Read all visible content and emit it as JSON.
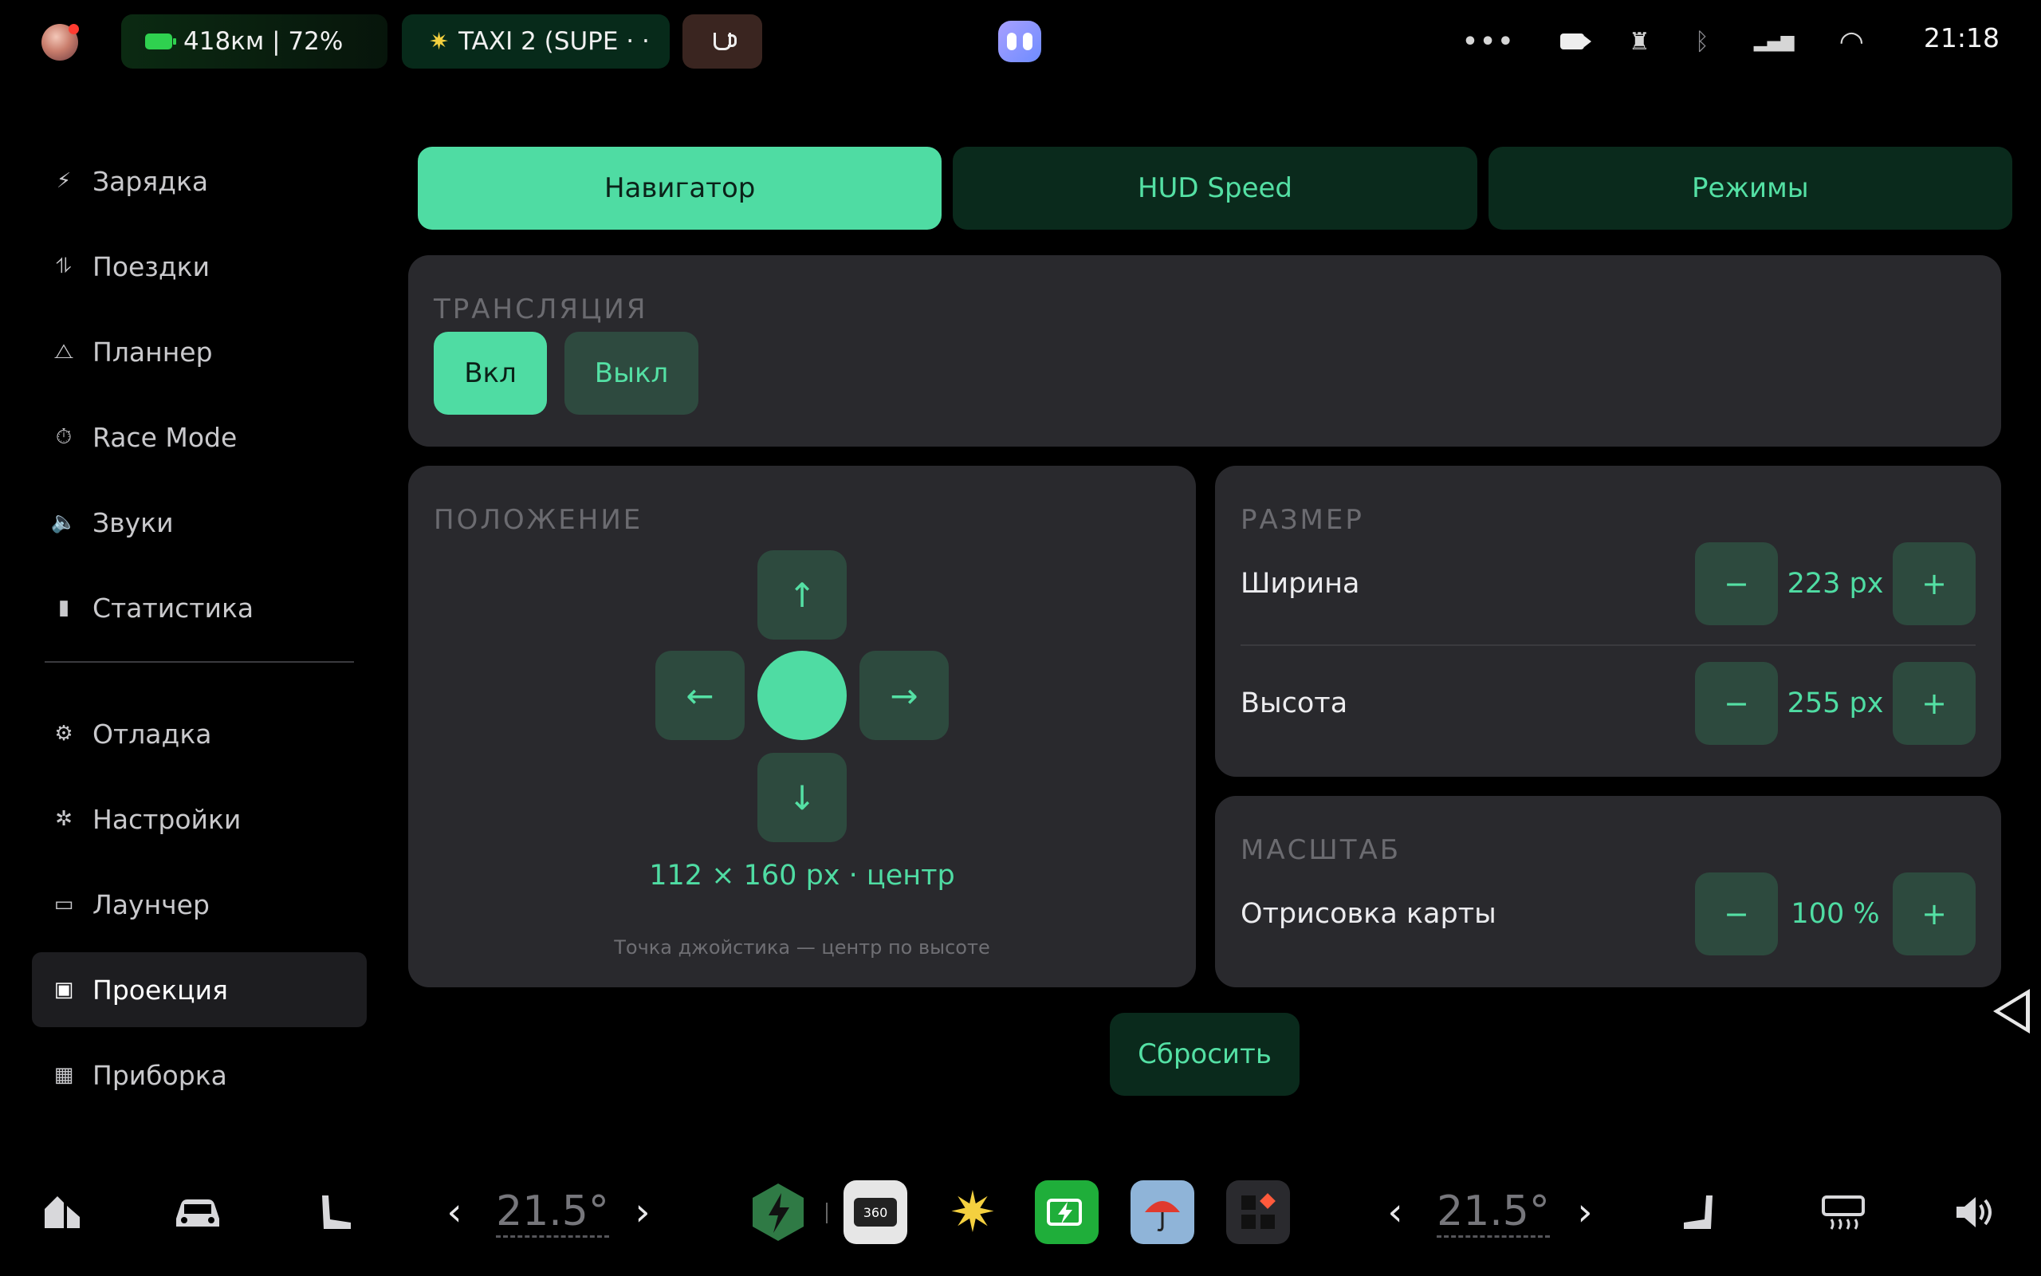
{
  "status_bar": {
    "battery_text": "418км | 72%",
    "taxi_text": "TAXI 2 (SUPE · ·",
    "time": "21:18",
    "icons": [
      "more-dots-icon",
      "camera-icon",
      "alarm-icon",
      "bluetooth-icon",
      "cellular-4g-icon",
      "wifi-icon"
    ],
    "more_symbol": "•••",
    "alarm_symbol": "♜",
    "bluetooth_symbol": "ᛒ",
    "cell_symbol": "▂▄▆",
    "wifi_symbol": "◠"
  },
  "sidebar": {
    "items": [
      {
        "label": "Зарядка",
        "icon": "⚡"
      },
      {
        "label": "Поездки",
        "icon": "⥮"
      },
      {
        "label": "Планнер",
        "icon": "⧍"
      },
      {
        "label": "Race Mode",
        "icon": "⏱"
      },
      {
        "label": "Звуки",
        "icon": "🔈"
      },
      {
        "label": "Статистика",
        "icon": "▮"
      },
      {
        "label": "Отладка",
        "icon": "⚙"
      },
      {
        "label": "Настройки",
        "icon": "✲"
      },
      {
        "label": "Лаунчер",
        "icon": "▭"
      },
      {
        "label": "Проекция",
        "icon": "▣"
      },
      {
        "label": "Приборка",
        "icon": "▦"
      }
    ],
    "active_index": 9
  },
  "tabs": [
    "Навигатор",
    "HUD Speed",
    "Режимы"
  ],
  "active_tab": 0,
  "translation": {
    "title": "ТРАНСЛЯЦИЯ",
    "on_label": "Вкл",
    "off_label": "Выкл",
    "state": "on"
  },
  "position": {
    "title": "ПОЛОЖЕНИЕ",
    "arrows": {
      "up": "↑",
      "down": "↓",
      "left": "←",
      "right": "→"
    },
    "readout": "112 × 160 px · центр",
    "hint": "Точка джойстика — центр по высоте"
  },
  "size": {
    "title": "РАЗМЕР",
    "width_label": "Ширина",
    "width_value": "223 px",
    "height_label": "Высота",
    "height_value": "255 px",
    "minus": "−",
    "plus": "+"
  },
  "scale": {
    "title": "МАСШТАБ",
    "label": "Отрисовка карты",
    "value": "100 %"
  },
  "reset_label": "Сбросить",
  "dock": {
    "left_temp": "21.5°",
    "right_temp": "21.5°",
    "chev_left": "‹",
    "chev_right": "›",
    "app_360_label": "360",
    "colors": {
      "accent": "#4fdca3",
      "accent_text": "#54e0a4",
      "card": "#29292d"
    }
  }
}
